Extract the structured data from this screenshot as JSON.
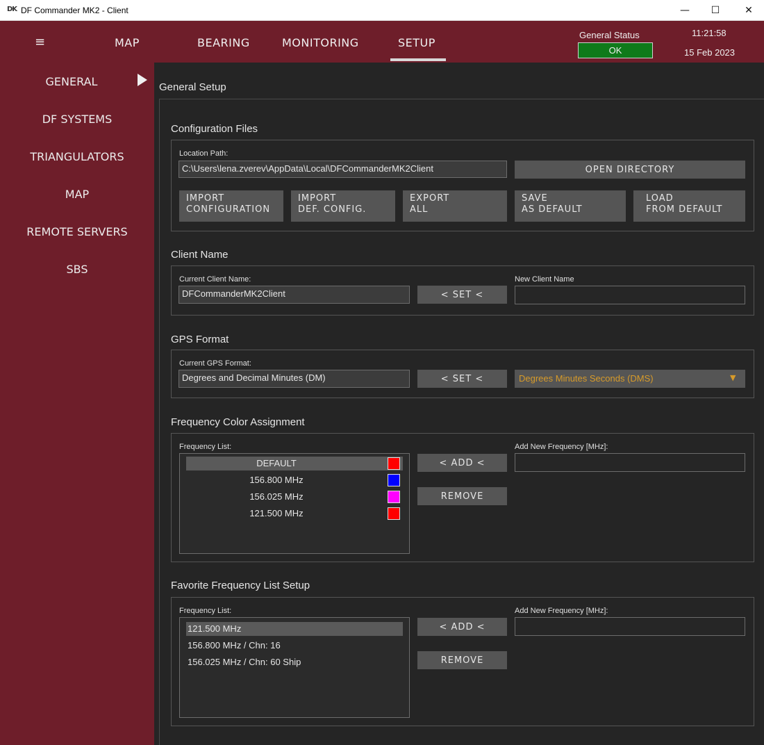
{
  "window": {
    "icon_text": "DK",
    "title": "DF Commander MK2 - Client",
    "minimize": "—",
    "maximize": "☐",
    "close": "✕"
  },
  "topbar": {
    "menu_icon": "≡",
    "tabs": [
      {
        "label": "MAP"
      },
      {
        "label": "BEARING"
      },
      {
        "label": "MONITORING"
      },
      {
        "label": "SETUP"
      }
    ],
    "active_tab": "SETUP",
    "status_label": "General Status",
    "status_value": "OK",
    "status_color": "#0f7a1a",
    "time": "11:21:58",
    "date": "15 Feb 2023"
  },
  "sidebar": {
    "items": [
      {
        "label": "GENERAL"
      },
      {
        "label": "DF SYSTEMS"
      },
      {
        "label": "TRIANGULATORS"
      },
      {
        "label": "MAP"
      },
      {
        "label": "REMOTE SERVERS"
      },
      {
        "label": "SBS"
      }
    ],
    "active": "GENERAL"
  },
  "page": {
    "title": "General Setup"
  },
  "config_files": {
    "title": "Configuration Files",
    "location_label": "Location Path:",
    "location_value": "C:\\Users\\lena.zverev\\AppData\\Local\\DFCommanderMK2Client",
    "open_directory": "OPEN DIRECTORY",
    "buttons": [
      {
        "line1": "IMPORT",
        "line2": "CONFIGURATION"
      },
      {
        "line1": "IMPORT",
        "line2": "DEF. CONFIG."
      },
      {
        "line1": "EXPORT",
        "line2": "ALL"
      },
      {
        "line1": "SAVE",
        "line2": "AS DEFAULT"
      },
      {
        "line1": "LOAD",
        "line2": "FROM DEFAULT"
      }
    ]
  },
  "client_name": {
    "title": "Client Name",
    "current_label": "Current Client Name:",
    "current_value": "DFCommanderMK2Client",
    "set_button": "< SET <",
    "new_label": "New Client Name",
    "new_value": ""
  },
  "gps_format": {
    "title": "GPS Format",
    "current_label": "Current GPS Format:",
    "current_value": "Degrees and Decimal Minutes (DM)",
    "set_button": "< SET <",
    "dropdown_value": "Degrees Minutes Seconds (DMS)",
    "dropdown_arrow": "▼",
    "dropdown_color": "#d79b2a"
  },
  "freq_color": {
    "title": "Frequency Color Assignment",
    "list_label": "Frequency List:",
    "items": [
      {
        "label": "DEFAULT",
        "color": "#ff0000"
      },
      {
        "label": "156.800 MHz",
        "color": "#0000ff"
      },
      {
        "label": "156.025 MHz",
        "color": "#ff00ff"
      },
      {
        "label": "121.500 MHz",
        "color": "#ff0000"
      }
    ],
    "add_button": "< ADD <",
    "remove_button": "REMOVE",
    "new_label": "Add New Frequency [MHz]:",
    "new_value": ""
  },
  "favorites": {
    "title": "Favorite Frequency List Setup",
    "list_label": "Frequency List:",
    "items": [
      {
        "label": "121.500 MHz"
      },
      {
        "label": "156.800 MHz / Chn: 16"
      },
      {
        "label": "156.025 MHz / Chn: 60 Ship"
      }
    ],
    "add_button": "< ADD <",
    "remove_button": "REMOVE",
    "new_label": "Add New Frequency [MHz]:",
    "new_value": ""
  }
}
